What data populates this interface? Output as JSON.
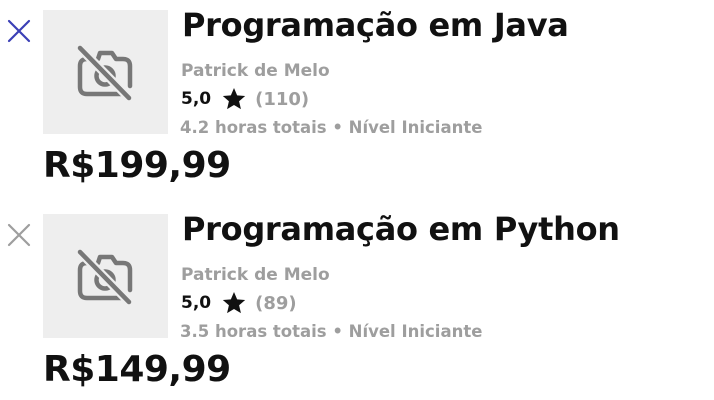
{
  "colors": {
    "remove_active": "#3b3fb6",
    "remove_muted": "#9e9e9e",
    "thumb_bg": "#eeeeee",
    "text_primary": "#111111",
    "text_muted": "#9e9e9e"
  },
  "courses": [
    {
      "title": "Programação em Java",
      "author": "Patrick de Melo",
      "rating": "5,0",
      "reviews": "(110)",
      "meta": "4.2 horas totais • Nível Iniciante",
      "price": "R$199,99",
      "remove_icon": "close-icon",
      "thumbnail_icon": "camera-off-icon"
    },
    {
      "title": "Programação em Python",
      "author": "Patrick de Melo",
      "rating": "5,0",
      "reviews": "(89)",
      "meta": "3.5 horas totais • Nível Iniciante",
      "price": "R$149,99",
      "remove_icon": "close-icon",
      "thumbnail_icon": "camera-off-icon"
    }
  ]
}
